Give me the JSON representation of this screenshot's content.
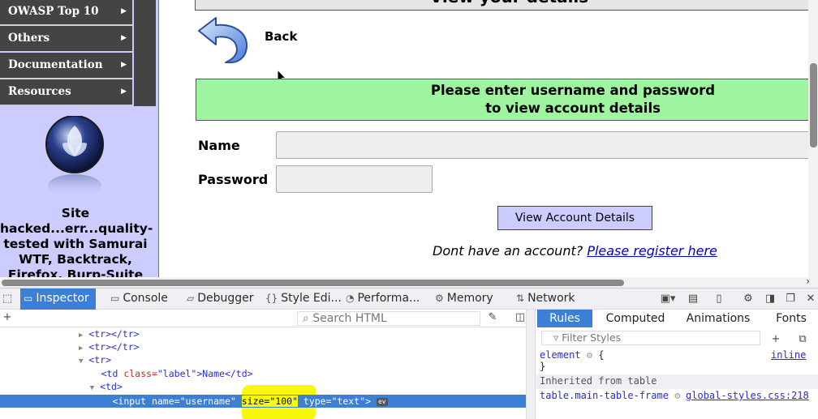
{
  "sidebar": {
    "menu_items": [
      {
        "label": "OWASP Top 10"
      },
      {
        "label": "Others"
      },
      {
        "label": "Documentation"
      },
      {
        "label": "Resources"
      }
    ],
    "caption": "Site hacked...err...quality-tested with Samurai WTF, Backtrack, Firefox, Burp-Suite"
  },
  "content": {
    "title": "View your details",
    "back_label": "Back",
    "notice_line1": "Please enter username and password",
    "notice_line2": "to view account details",
    "name_label": "Name",
    "password_label": "Password",
    "view_button": "View Account Details",
    "register_prefix": "Dont have an account?",
    "register_link": "Please register here"
  },
  "devtools": {
    "tabs": [
      {
        "label": "Inspector",
        "icon": "inspector-icon",
        "active": true
      },
      {
        "label": "Console",
        "icon": "console-icon"
      },
      {
        "label": "Debugger",
        "icon": "debugger-icon"
      },
      {
        "label": "Style Edi...",
        "icon": "style-editor-icon"
      },
      {
        "label": "Performa...",
        "icon": "performance-icon"
      },
      {
        "label": "Memory",
        "icon": "memory-icon"
      },
      {
        "label": "Network",
        "icon": "network-icon"
      }
    ],
    "search_placeholder": "Search HTML",
    "markup": {
      "tr1": "<tr></tr>",
      "tr2": "<tr></tr>",
      "tr_open": "<tr>",
      "td_label_tag": "<td ",
      "td_label_attr": "class=",
      "td_label_val": "\"label\"",
      "td_label_text": ">Name</td>",
      "td_open": "<td>",
      "input_prefix": "<input name=\"username\" ",
      "input_highlight": "size=\"100\"",
      "input_suffix": " type=\"text\">",
      "event_badge": "ev"
    },
    "side_tabs": [
      {
        "label": "Rules",
        "active": true
      },
      {
        "label": "Computed"
      },
      {
        "label": "Animations"
      },
      {
        "label": "Fonts"
      }
    ],
    "filter_placeholder": "Filter Styles",
    "rules": {
      "element_selector": "element",
      "element_open": "{",
      "element_source": "inline",
      "element_close": "}",
      "inherited_header": "Inherited from table",
      "table_selector": "table.main-table-frame",
      "table_source": "global-styles.css:218"
    }
  },
  "colors": {
    "notice_bg": "#9ff59f",
    "sidebar_bg": "#ccccff",
    "menu_bg": "#444444",
    "devtools_accent": "#3b7fd6",
    "highlight": "#ffff00",
    "link": "#0000cc"
  }
}
